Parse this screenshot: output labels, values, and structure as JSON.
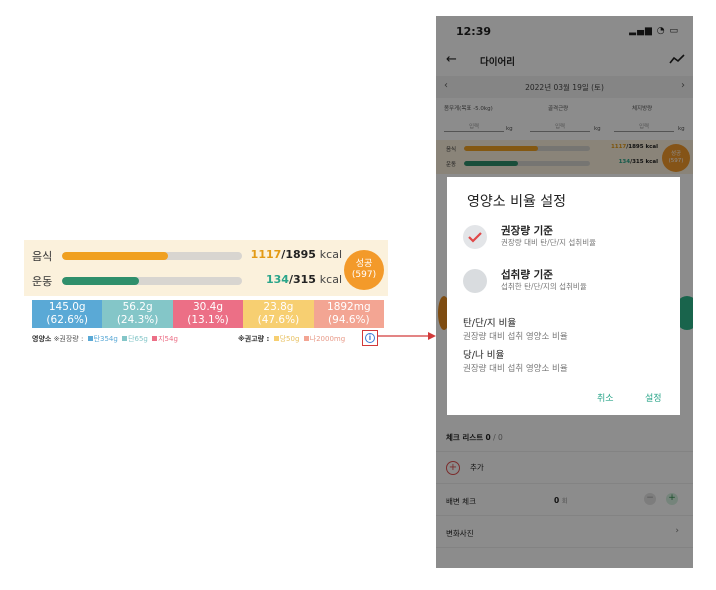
{
  "zoom": {
    "food_label": "음식",
    "exercise_label": "운동",
    "food_value": "1117",
    "food_goal": "/1895",
    "exercise_value": "134",
    "exercise_goal": "/315",
    "unit": "kcal",
    "food_progress": 0.59,
    "exercise_progress": 0.43,
    "badge_line1": "성공",
    "badge_line2": "(597)",
    "nutrients": [
      {
        "amount": "145.0g",
        "pct": "(62.6%)",
        "color": "#5aa9d6"
      },
      {
        "amount": "56.2g",
        "pct": "(24.3%)",
        "color": "#84c6c8"
      },
      {
        "amount": "30.4g",
        "pct": "(13.1%)",
        "color": "#ec6f86"
      },
      {
        "amount": "23.8g",
        "pct": "(47.6%)",
        "color": "#f7cf71"
      },
      {
        "amount": "1892mg",
        "pct": "(94.6%)",
        "color": "#f3a593"
      }
    ],
    "legend_left_title": "영양소",
    "legend_left_sub": "※권장량 :",
    "legend_carb": "탄354g",
    "legend_protein": "단65g",
    "legend_fat": "지54g",
    "legend_right_sub": "※권고량 :",
    "legend_sugar": "당50g",
    "legend_sodium": "나2000mg",
    "info_glyph": "i"
  },
  "phone": {
    "time": "12:39",
    "status_icons": "▂▄▆ ◔ ▭",
    "back_glyph": "←",
    "title": "다이어리",
    "date": "2022년 03월 19일 (토)",
    "prev": "‹",
    "next": "›",
    "weight_label": "몸무게(목표 -5.0kg)",
    "muscle_label": "골격근량",
    "fat_label": "체지방량",
    "input_placeholder": "입력",
    "kg": "kg",
    "food_label": "음식",
    "exercise_label": "운동",
    "food_value": "1117",
    "food_goal": "/1895 kcal",
    "exercise_value": "134",
    "exercise_goal": "/315 kcal",
    "badge_line1": "성공",
    "badge_line2": "(597)",
    "checklist_label": "체크 리스트",
    "checklist_value": "0",
    "checklist_total": "/ 0",
    "add_label": "추가",
    "bowel_label": "배변 체크",
    "bowel_value": "0",
    "bowel_unit": "회",
    "photo_label": "변화사진",
    "minus_glyph": "−",
    "plus_glyph": "+",
    "chev_glyph": "›"
  },
  "dialog": {
    "title": "영양소 비율 설정",
    "option1_title": "권장량 기준",
    "option1_sub": "권장량 대비 탄/단/지 섭취비율",
    "option2_title": "섭취량 기준",
    "option2_sub": "섭취한 탄/단/지의 섭취비율",
    "sec1_title": "탄/단/지 비율",
    "sec1_sub": "권장량 대비 섭취 영양소 비율",
    "sec2_title": "당/나 비율",
    "sec2_sub": "권장량 대비 섭취 영양소 비율",
    "cancel": "취소",
    "confirm": "설정",
    "selected_option": 1
  },
  "colors": {
    "food_bar": "#f0a020",
    "exercise_bar": "#2f8f6b",
    "accent": "#2aa58a",
    "badge": "#f39a2a",
    "arrow": "#d23a3a"
  }
}
